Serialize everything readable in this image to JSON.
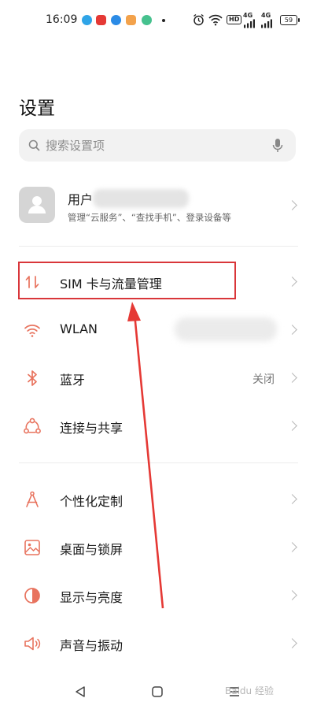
{
  "status_bar": {
    "time": "16:09",
    "hd_badge": "HD",
    "net1": "4G",
    "net2": "4G",
    "battery": "59"
  },
  "page_title": "设置",
  "search": {
    "placeholder": "搜索设置项"
  },
  "account": {
    "name": "用户",
    "description": "管理“云服务”、“查找手机”、登录设备等"
  },
  "items": [
    {
      "label": "SIM 卡与流量管理",
      "icon": "sim-transfer-icon"
    },
    {
      "label": "WLAN",
      "icon": "wifi-icon"
    },
    {
      "label": "蓝牙",
      "value": "关闭",
      "icon": "bluetooth-icon"
    },
    {
      "label": "连接与共享",
      "icon": "share-icon"
    },
    {
      "label": "个性化定制",
      "icon": "compass-icon"
    },
    {
      "label": "桌面与锁屏",
      "icon": "wallpaper-icon"
    },
    {
      "label": "显示与亮度",
      "icon": "brightness-icon"
    },
    {
      "label": "声音与振动",
      "icon": "speaker-icon"
    }
  ],
  "colors": {
    "accent_icon": "#e8735e",
    "highlight_box": "#d9363a",
    "search_bg": "#f2f2f2"
  },
  "watermark": "Baidu 经验"
}
